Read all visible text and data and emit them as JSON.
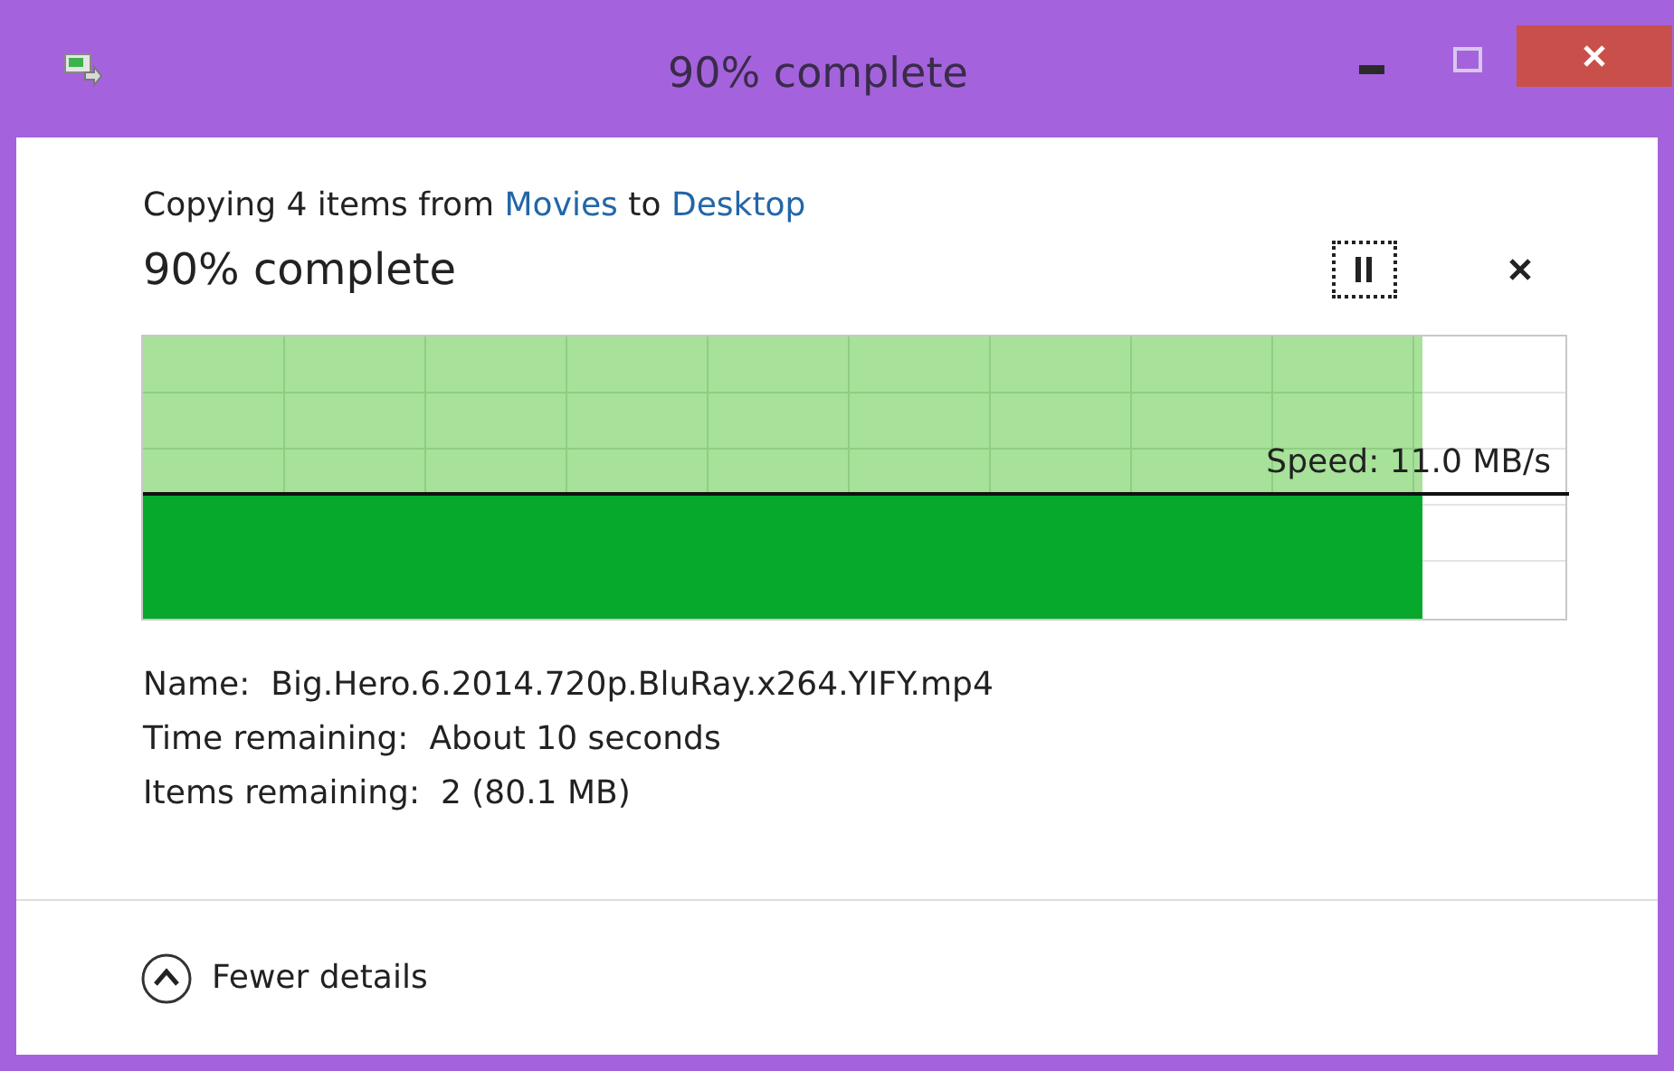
{
  "window": {
    "title": "90% complete"
  },
  "header": {
    "prefix": "Copying 4 items from",
    "source": "Movies",
    "middle": "to",
    "destination": "Desktop"
  },
  "status": "90% complete",
  "graph": {
    "speed": "Speed: 11.0 MB/s"
  },
  "details": [
    {
      "label": "Name:",
      "value": "Big.Hero.6.2014.720p.BluRay.x264.YIFY.mp4"
    },
    {
      "label": "Time remaining:",
      "value": "About 10 seconds"
    },
    {
      "label": "Items remaining:",
      "value": "2 (80.1 MB)"
    }
  ],
  "footer": {
    "toggle": "Fewer details"
  }
}
